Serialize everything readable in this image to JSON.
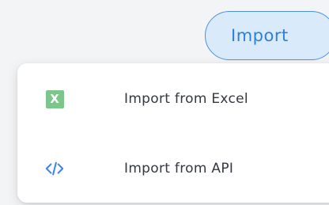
{
  "import_button": {
    "label": "Import"
  },
  "menu": {
    "items": [
      {
        "label": "Import from Excel",
        "icon": "excel-icon",
        "icon_text": "X",
        "icon_color": "#7cc58b"
      },
      {
        "label": "Import from API",
        "icon": "code-icon",
        "icon_color": "#3b82f6"
      }
    ]
  },
  "colors": {
    "accent": "#2f7fd8",
    "button_bg": "#d9ebfa",
    "text": "#333840"
  }
}
